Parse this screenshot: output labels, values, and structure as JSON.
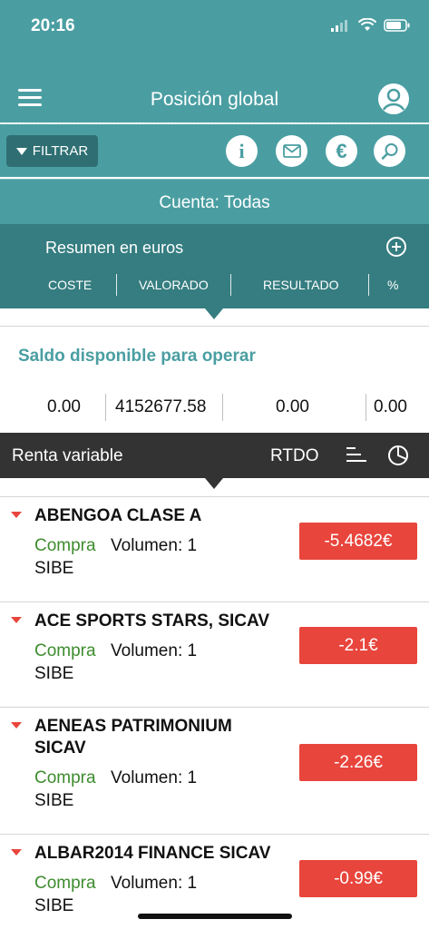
{
  "status_bar": {
    "time": "20:16"
  },
  "header": {
    "title": "Posición global"
  },
  "toolbar": {
    "filter_label": "FILTRAR",
    "info_label": "i",
    "euro_label": "€"
  },
  "account": {
    "label": "Cuenta: Todas"
  },
  "summary": {
    "title": "Resumen en euros",
    "columns": [
      "COSTE",
      "VALORADO",
      "RESULTADO",
      "%"
    ]
  },
  "balance": {
    "title": "Saldo disponible para operar",
    "values": [
      "0.00",
      "4152677.58",
      "0.00",
      "0.00"
    ]
  },
  "equities": {
    "title": "Renta variable",
    "sort_label": "RTDO"
  },
  "positions": [
    {
      "name": "ABENGOA CLASE A",
      "type": "Compra",
      "volume": "Volumen: 1",
      "market": "SIBE",
      "result": "-5.4682€"
    },
    {
      "name": "ACE SPORTS STARS, SICAV",
      "type": "Compra",
      "volume": "Volumen: 1",
      "market": "SIBE",
      "result": "-2.1€"
    },
    {
      "name": "AENEAS PATRIMONIUM SICAV",
      "type": "Compra",
      "volume": "Volumen: 1",
      "market": "SIBE",
      "result": "-2.26€"
    },
    {
      "name": "ALBAR2014 FINANCE SICAV",
      "type": "Compra",
      "volume": "Volumen: 1",
      "market": "SIBE",
      "result": "-0.99€"
    }
  ],
  "icons": {
    "menu": "hamburger-menu-icon",
    "profile": "user-profile-icon",
    "filter": "filter-triangle-icon",
    "info": "info-icon",
    "mail": "mail-icon",
    "euro": "euro-icon",
    "search": "search-icon",
    "add": "plus-circle-icon",
    "sort": "sort-lines-icon",
    "chart": "pie-chart-icon",
    "loss": "down-triangle-icon"
  },
  "colors": {
    "primary": "#4a9ea2",
    "primary_dark": "#357d80",
    "filter_button": "#2f6f73",
    "section_bar": "#333333",
    "loss": "#e8453c",
    "buy": "#3d8c2e"
  }
}
